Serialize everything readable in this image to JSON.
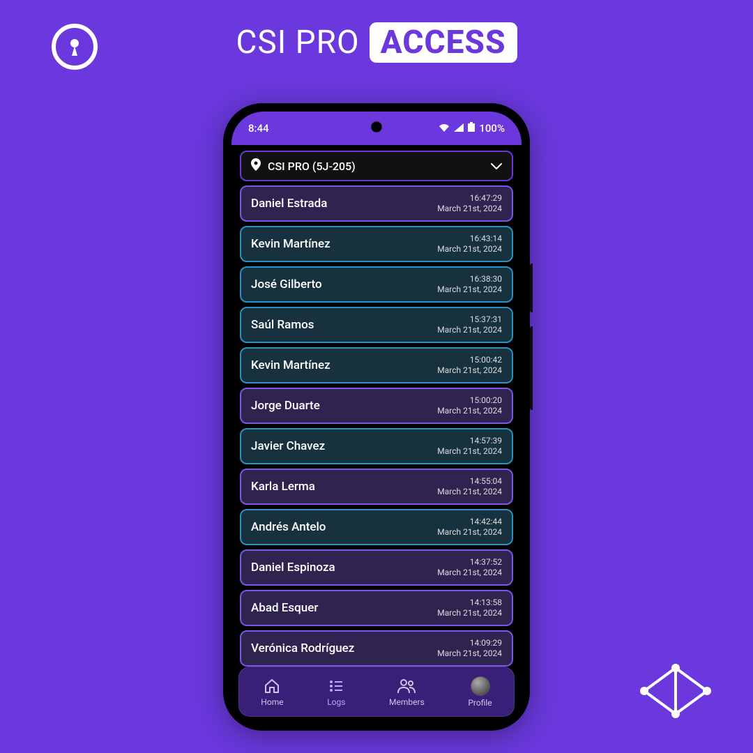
{
  "colors": {
    "brand": "#6A38DC",
    "accent_blue": "#2C8FC3",
    "accent_purple": "#7B55E8"
  },
  "header": {
    "title_a": "CSI PRO",
    "title_b": "ACCESS"
  },
  "statusbar": {
    "time": "8:44",
    "battery": "100%"
  },
  "dropdown": {
    "selected": "CSI PRO (5J-205)"
  },
  "logs": [
    {
      "name": "Daniel Estrada",
      "time": "16:47:29",
      "date": "March 21st, 2024",
      "variant": "purple"
    },
    {
      "name": "Kevin Martínez",
      "time": "16:43:14",
      "date": "March 21st, 2024",
      "variant": "blue"
    },
    {
      "name": "José Gilberto",
      "time": "16:38:30",
      "date": "March 21st, 2024",
      "variant": "blue"
    },
    {
      "name": "Saúl Ramos",
      "time": "15:37:31",
      "date": "March 21st, 2024",
      "variant": "blue"
    },
    {
      "name": "Kevin Martínez",
      "time": "15:00:42",
      "date": "March 21st, 2024",
      "variant": "blue"
    },
    {
      "name": "Jorge Duarte",
      "time": "15:00:20",
      "date": "March 21st, 2024",
      "variant": "purple"
    },
    {
      "name": "Javier Chavez",
      "time": "14:57:39",
      "date": "March 21st, 2024",
      "variant": "blue"
    },
    {
      "name": "Karla Lerma",
      "time": "14:55:04",
      "date": "March 21st, 2024",
      "variant": "purple"
    },
    {
      "name": "Andrés Antelo",
      "time": "14:42:44",
      "date": "March 21st, 2024",
      "variant": "blue"
    },
    {
      "name": "Daniel Espinoza",
      "time": "14:37:52",
      "date": "March 21st, 2024",
      "variant": "purple"
    },
    {
      "name": "Abad Esquer",
      "time": "14:13:58",
      "date": "March 21st, 2024",
      "variant": "purple"
    },
    {
      "name": "Verónica Rodríguez",
      "time": "14:09:29",
      "date": "March 21st, 2024",
      "variant": "purple"
    }
  ],
  "nav": {
    "items": [
      {
        "label": "Home",
        "icon": "home-icon",
        "active": false
      },
      {
        "label": "Logs",
        "icon": "list-icon",
        "active": true
      },
      {
        "label": "Members",
        "icon": "people-icon",
        "active": false
      },
      {
        "label": "Profile",
        "icon": "avatar-icon",
        "active": false
      }
    ]
  }
}
